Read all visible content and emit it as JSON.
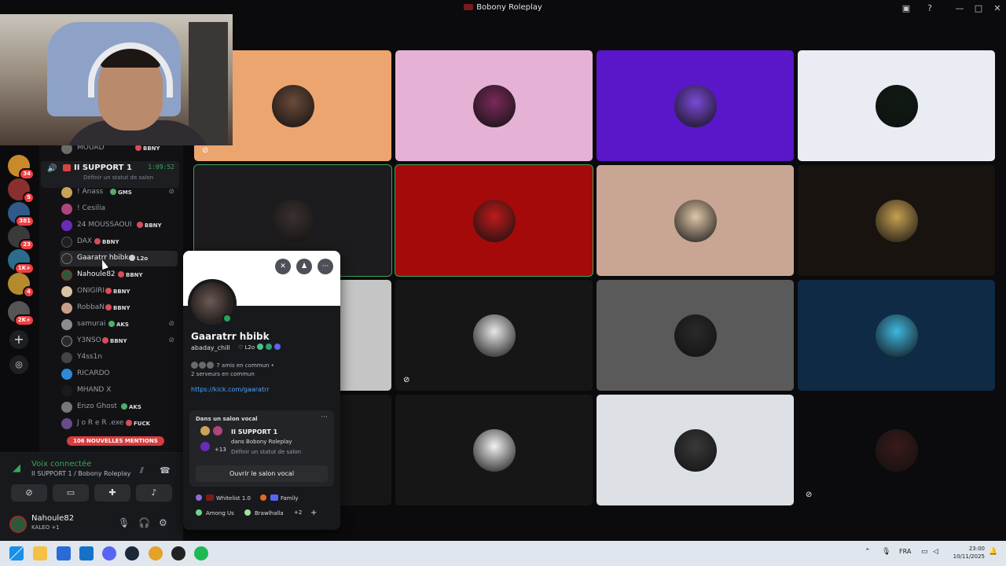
{
  "window": {
    "title": "Bobony Roleplay"
  },
  "rail": {
    "badges": [
      "34",
      "5",
      "381",
      "23",
      "1K+",
      "4",
      "2K+"
    ]
  },
  "voice_channel": {
    "name": "II SUPPORT 1",
    "timer": "1:09:52",
    "status_hint": "Définir un statut de salon",
    "members": [
      {
        "name": "MOUAD",
        "tag": "BBNY"
      },
      {
        "name": "! Anass",
        "tag": "GMS",
        "muted": true
      },
      {
        "name": "! Cesilia",
        "tag": ""
      },
      {
        "name": "24 MOUSSAOUI",
        "tag": "BBNY"
      },
      {
        "name": "DAX",
        "tag": "BBNY"
      },
      {
        "name": "Gaaratrr hbibk",
        "tag": "L2o"
      },
      {
        "name": "Nahoule82",
        "tag": "BBNY"
      },
      {
        "name": "ONIGIRI",
        "tag": "BBNY"
      },
      {
        "name": "RobbaN",
        "tag": "BBNY"
      },
      {
        "name": "samurai",
        "tag": "AKS",
        "muted": true
      },
      {
        "name": "Y3NSO",
        "tag": "BBNY",
        "muted": true
      },
      {
        "name": "Y4ss1n",
        "tag": ""
      },
      {
        "name": "RICARDO",
        "tag": ""
      },
      {
        "name": "MHAND X",
        "tag": ""
      },
      {
        "name": "Enzo Ghost",
        "tag": "AKS"
      },
      {
        "name": "J o R e R .exe",
        "tag": "FUCK"
      }
    ],
    "mentions_banner": "106 NOUVELLES MENTIONS"
  },
  "voice_panel": {
    "connected_label": "Voix connectée",
    "channel_path": "II SUPPORT 1 / Bobony Roleplay"
  },
  "user": {
    "name": "Nahoule82",
    "activity": "KALEO +1"
  },
  "tile_colors": [
    "#eda56f",
    "#e5b2d6",
    "#5a16c9",
    "#e9ecf2",
    "#1c1b1d",
    "#a50a0a",
    "#c9a594",
    "#18130f",
    "#c5c5c5",
    "#161616",
    "#5a5a5a",
    "#0e2a45",
    "#161616",
    "#161616",
    "#dde1e6",
    "#0b0b0d"
  ],
  "profile": {
    "display_name": "Gaaratrr hbibk",
    "username": "abaday_chill",
    "guild_tag": "L2o",
    "mutual_friends": "7 amis en commun",
    "mutual_servers": "2 serveurs en commun",
    "link": "https://kick.com/gaaratrr",
    "voice_header": "Dans un salon vocal",
    "voice_channel": "II SUPPORT 1",
    "voice_server": "dans Bobony Roleplay",
    "voice_status": "Définir un statut de salon",
    "voice_extra": "+13",
    "open_button": "Ouvrir le salon vocal",
    "roles": [
      "Whitelist 1.0",
      "Family",
      "Among Us",
      "Brawlhalla",
      "+2"
    ]
  },
  "taskbar": {
    "lang": "FRA",
    "time": "23:00",
    "date": "10/11/2025"
  }
}
